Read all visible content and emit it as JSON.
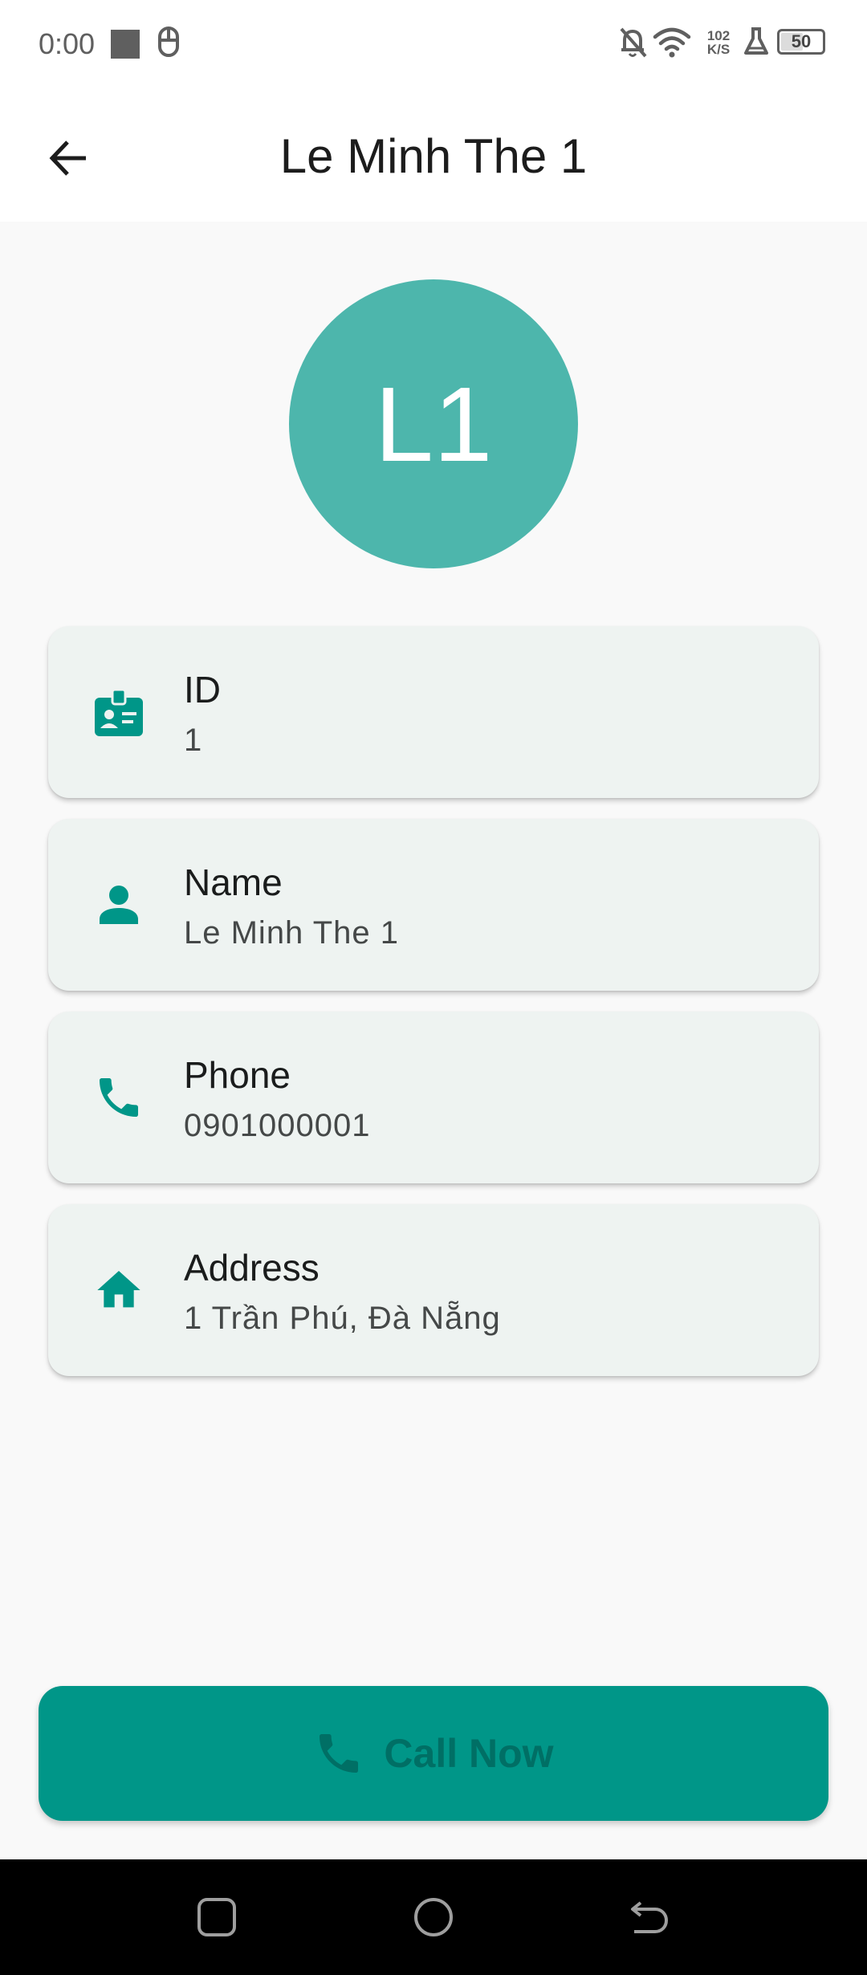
{
  "status_bar": {
    "time": "0:00",
    "net_speed_value": "102",
    "net_speed_unit": "K/S",
    "battery_level": "50",
    "icons": [
      "media-square-icon",
      "mouse-icon",
      "bell-off-icon",
      "wifi-icon",
      "net-speed",
      "flask-icon",
      "battery-icon"
    ]
  },
  "app_bar": {
    "title": "Le Minh The 1",
    "back_icon": "arrow-back-icon"
  },
  "avatar": {
    "initials": "L1",
    "color": "#4db6ac"
  },
  "details": [
    {
      "icon": "badge-icon",
      "label": "ID",
      "value": "1"
    },
    {
      "icon": "person-icon",
      "label": "Name",
      "value": "Le Minh The 1"
    },
    {
      "icon": "phone-icon",
      "label": "Phone",
      "value": "0901000001"
    },
    {
      "icon": "home-icon",
      "label": "Address",
      "value": "1 Trần Phú, Đà Nẵng"
    }
  ],
  "call_button": {
    "label": "Call Now",
    "icon": "phone-icon",
    "background": "#009688",
    "foreground": "#006f65"
  },
  "nav_bar": {
    "icons": [
      "recents-icon",
      "home-circle-icon",
      "back-gesture-icon"
    ]
  },
  "theme": {
    "accent": "#009688",
    "card_background": "#eef3f1",
    "page_background": "#f9f9f9"
  }
}
